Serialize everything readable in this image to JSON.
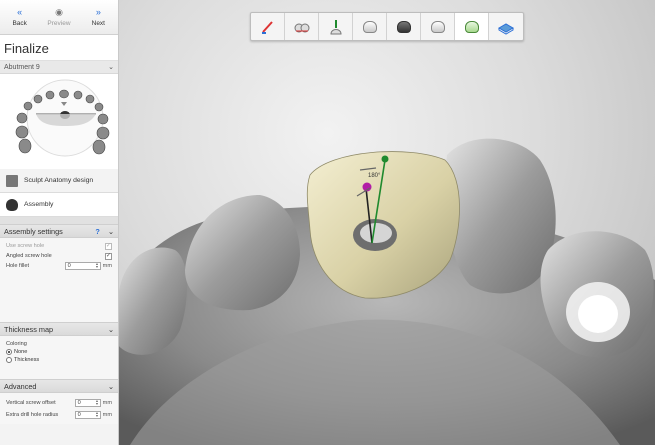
{
  "nav": {
    "back_label": "Back",
    "preview_label": "Preview",
    "next_label": "Next",
    "back_icon": "double-chevron-left-icon",
    "preview_icon": "eye-icon",
    "next_icon": "double-chevron-right-icon"
  },
  "panel": {
    "title": "Finalize",
    "abutment_label": "Abutment 9",
    "tools": [
      {
        "label": "Sculpt Anatomy design",
        "icon": "sculpt-icon"
      },
      {
        "label": "Assembly",
        "icon": "assembly-icon"
      }
    ]
  },
  "assembly_settings": {
    "title": "Assembly settings",
    "help_label": "?",
    "use_screw_hole_label": "Use screw hole",
    "use_screw_hole_checked": true,
    "angled_screw_hole_label": "Angled screw hole",
    "angled_screw_hole_checked": true,
    "hole_fillet_label": "Hole fillet",
    "hole_fillet_value": "0",
    "hole_fillet_unit": "mm"
  },
  "thickness_map": {
    "title": "Thickness map",
    "coloring_label": "Coloring",
    "options": [
      "None",
      "Thickness"
    ],
    "selected": "None"
  },
  "advanced": {
    "title": "Advanced",
    "vertical_offset_label": "Vertical screw offset",
    "vertical_offset_value": "0",
    "drill_radius_label": "Extra drill hole radius",
    "drill_radius_value": "0",
    "unit": "mm"
  },
  "toolbar": {
    "active_index": 7,
    "icons": [
      "scan-prep-icon",
      "margin-line-icon",
      "insertion-direction-icon",
      "tooth-icon",
      "dark-tooth-icon",
      "tooth-icon",
      "finalize-tooth-icon",
      "export-icon"
    ]
  },
  "viewport": {
    "gizmo_label": "180°"
  },
  "colors": {
    "accent": "#2b6fd6",
    "abutment": "#e6dfba",
    "gizmo_handle": "#b21ea6"
  }
}
